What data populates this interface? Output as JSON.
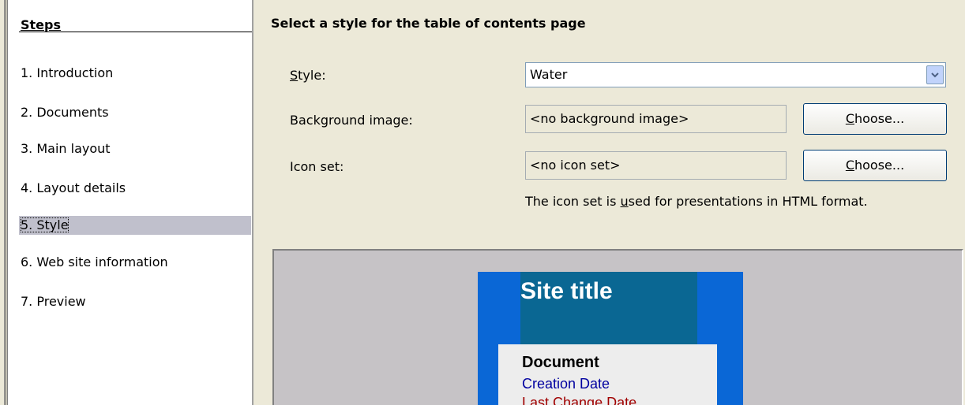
{
  "sidebar": {
    "heading": "Steps",
    "items": [
      {
        "label": "1.  Introduction"
      },
      {
        "label": "2.  Documents"
      },
      {
        "label": "3.  Main layout"
      },
      {
        "label": "4.  Layout details"
      },
      {
        "label": "5.  Style",
        "selected": true
      },
      {
        "label": "6.  Web site information"
      },
      {
        "label": "7.  Preview"
      }
    ]
  },
  "main": {
    "title": "Select a style for the table of contents page",
    "style": {
      "label_mnemonic": "S",
      "label_rest": "tyle:",
      "value": "Water",
      "dropdown_icon": "chevron-down-icon"
    },
    "background_image": {
      "label": "Background image:",
      "value": "<no background image>",
      "button_mnemonic": "C",
      "button_rest": "hoose..."
    },
    "icon_set": {
      "label": "Icon set:",
      "value": "<no icon set>",
      "button_mnemonic": "C",
      "button_rest": "hoose..."
    },
    "hint": {
      "before": "The icon set is ",
      "mnemonic": "u",
      "after": "sed for presentations in HTML format."
    }
  },
  "preview": {
    "site_title": "Site title",
    "document": "Document",
    "creation_date": "Creation Date",
    "last_change": "Last Change Date",
    "colors": {
      "frame": "#0a67d6",
      "header": "#0a6793",
      "body": "#ededed",
      "creation_date_text": "#0000a0",
      "last_change_text": "#a00000"
    }
  }
}
